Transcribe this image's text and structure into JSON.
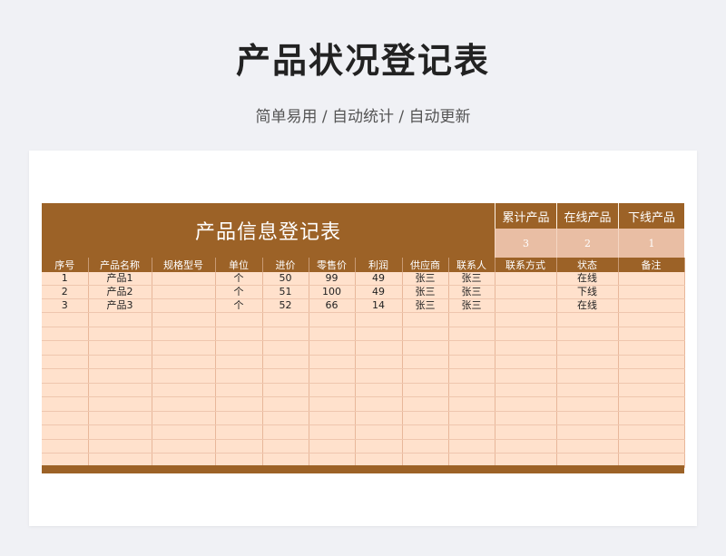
{
  "header": {
    "title": "产品状况登记表",
    "subtitle": "简单易用 / 自动统计 / 自动更新"
  },
  "sheet": {
    "banner": "产品信息登记表",
    "stats": [
      {
        "label": "累计产品",
        "value": "3"
      },
      {
        "label": "在线产品",
        "value": "2"
      },
      {
        "label": "下线产品",
        "value": "1"
      }
    ],
    "columns": [
      "序号",
      "产品名称",
      "规格型号",
      "单位",
      "进价",
      "零售价",
      "利润",
      "供应商",
      "联系人",
      "联系方式",
      "状态",
      "备注"
    ],
    "rows": [
      [
        "1",
        "产品1",
        "",
        "个",
        "50",
        "99",
        "49",
        "张三",
        "张三",
        "",
        "在线",
        ""
      ],
      [
        "2",
        "产品2",
        "",
        "个",
        "51",
        "100",
        "49",
        "张三",
        "张三",
        "",
        "下线",
        ""
      ],
      [
        "3",
        "产品3",
        "",
        "个",
        "52",
        "66",
        "14",
        "张三",
        "张三",
        "",
        "在线",
        ""
      ]
    ],
    "empty_rows": 11
  },
  "colors": {
    "header_brown": "#9c6227",
    "row_fill": "#ffe1cc",
    "stat_value_fill": "#e9bea4"
  }
}
